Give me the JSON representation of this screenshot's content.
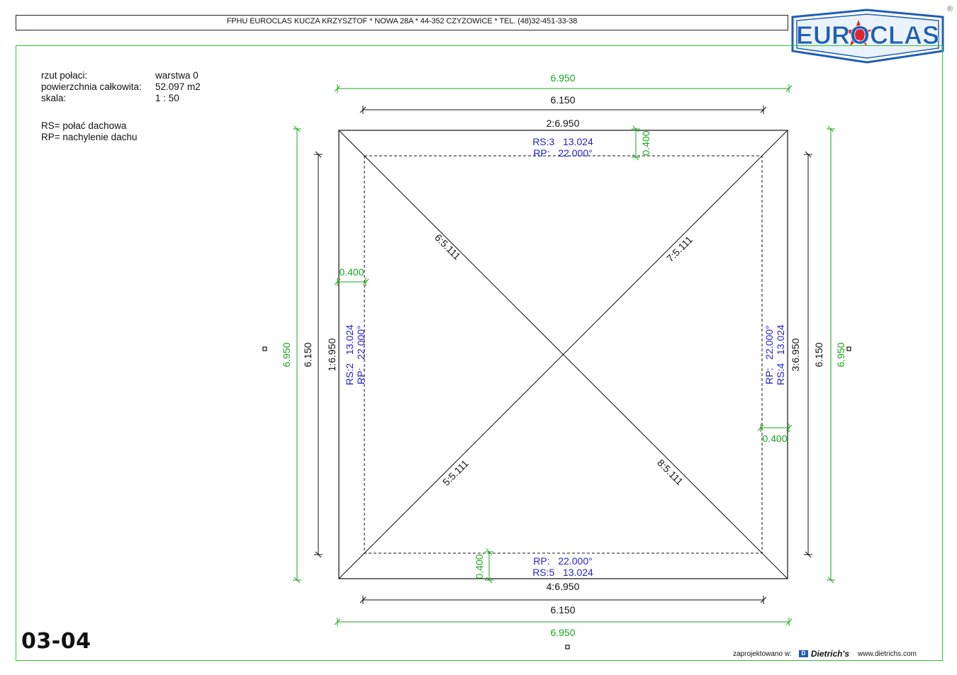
{
  "header": {
    "company_line": "FPHU EUROCLAS KUCZA KRZYSZTOF * NOWA 28A * 44-352 CZYZOWICE * TEL. (48)32-451-33-38"
  },
  "logo": {
    "text": "EUROCLAS",
    "registered_mark": "®"
  },
  "info": {
    "rows": [
      {
        "label": "rzut połaci:",
        "value": "warstwa 0"
      },
      {
        "label": "powierzchnia całkowita:",
        "value": "52.097 m2"
      },
      {
        "label": "skala:",
        "value": "1 : 50"
      }
    ]
  },
  "legend": {
    "rs": "RS= połać dachowa",
    "rp": "RP= nachylenie dachu"
  },
  "sheet_number": "03-04",
  "footer": {
    "designed_in": "zaprojektowano w:",
    "brand": "Dietrich's",
    "website": "www.dietrichs.com"
  },
  "colors": {
    "frame_green": "#2fc82f",
    "dimension_green": "#1aa51a",
    "label_blue": "#2222cc",
    "line_black": "#111111",
    "logo_blue": "#1f5fb5",
    "logo_red": "#e0262d"
  },
  "drawing": {
    "overall_top": "6.950",
    "inner_top": "6.150",
    "overall_bottom": "6.950",
    "inner_bottom": "6.150",
    "overall_left": "6.950",
    "inner_left": "6.150",
    "overall_right": "6.950",
    "inner_right": "6.150",
    "edge_top": "2:6.950",
    "edge_bottom": "4:6.950",
    "edge_left": "1:6.950",
    "edge_right": "3:6.950",
    "overhang_top": "0.400",
    "overhang_bottom": "0.400",
    "overhang_left": "0.400",
    "overhang_right": "0.400",
    "hip_tl": "6:5.111",
    "hip_tr": "7:5.111",
    "hip_bl": "5:5.111",
    "hip_br": "8:5.111",
    "plane_top": {
      "rs": "RS:3   13.024",
      "rp": "RP:   22.000°"
    },
    "plane_bottom": {
      "rp": "RP:   22.000°",
      "rs": "RS:5   13.024"
    },
    "plane_left": {
      "rs": "RS:2   13.024",
      "rp": "RP:   22.000°"
    },
    "plane_right": {
      "rp": "RP:   22.000°",
      "rs": "RS:4   13.024"
    }
  }
}
